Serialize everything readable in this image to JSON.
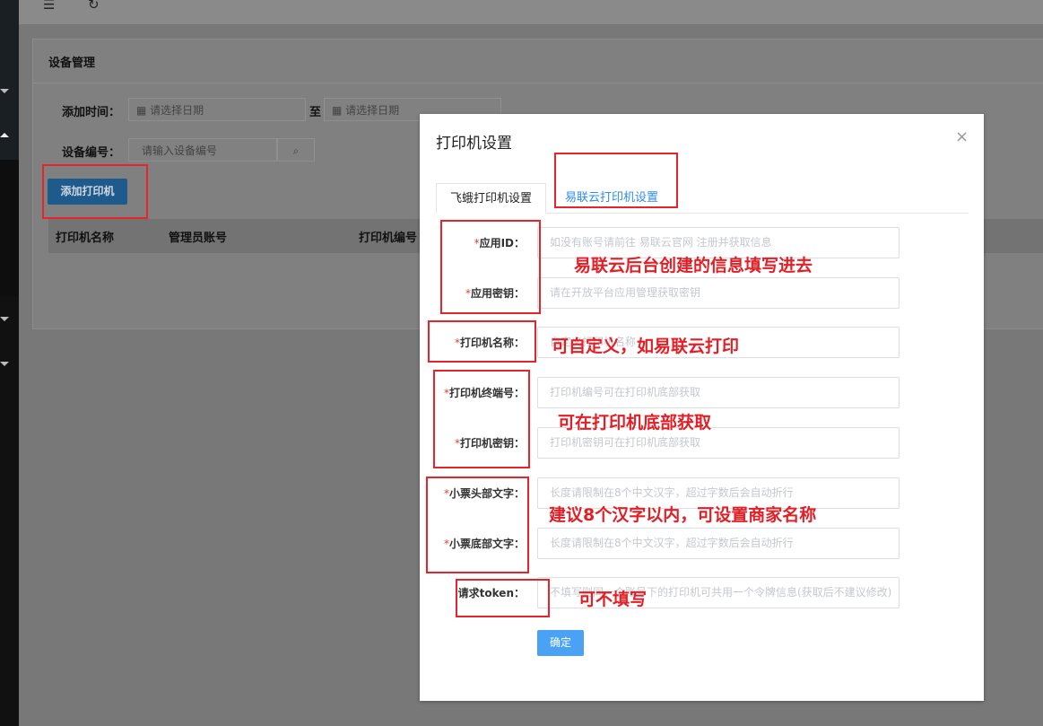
{
  "page": {
    "section_title": "设备管理",
    "filters": {
      "add_time_label": "添加时间：",
      "date_placeholder_start": "请选择日期",
      "date_to": "至",
      "date_placeholder_end": "请选择日期",
      "device_no_label": "设备编号：",
      "device_no_placeholder": "请输入设备编号"
    },
    "add_printer_button": "添加打印机",
    "table_headers": [
      "打印机名称",
      "管理员账号",
      "打印机编号"
    ]
  },
  "modal": {
    "title": "打印机设置",
    "close": "×",
    "tabs": [
      {
        "label": "飞蛾打印机设置",
        "active": true
      },
      {
        "label": "易联云打印机设置",
        "active": false
      }
    ],
    "fields": [
      {
        "required": true,
        "label": "应用ID：",
        "placeholder": "如没有账号请前往 易联云官网 注册并获取信息"
      },
      {
        "required": true,
        "label": "应用密钥：",
        "placeholder": "请在开放平台应用管理获取密钥"
      },
      {
        "required": true,
        "label": "打印机名称：",
        "placeholder": "自定义打印机名称"
      },
      {
        "required": true,
        "label": "打印机终端号：",
        "placeholder": "打印机编号可在打印机底部获取"
      },
      {
        "required": true,
        "label": "打印机密钥：",
        "placeholder": "打印机密钥可在打印机底部获取"
      },
      {
        "required": true,
        "label": "小票头部文字：",
        "placeholder": "长度请限制在8个中文汉字，超过字数后会自动折行"
      },
      {
        "required": true,
        "label": "小票底部文字：",
        "placeholder": "长度请限制在8个中文汉字，超过字数后会自动折行"
      },
      {
        "required": false,
        "label": "请求token：",
        "placeholder": "不填写则同一个账号下的打印机可共用一个令牌信息(获取后不建议修改)"
      }
    ],
    "confirm_button": "确定"
  },
  "annotations": [
    "易联云后台创建的信息填写进去",
    "可自定义，如易联云打印",
    "可在打印机底部获取",
    "建议8个汉字以内，可设置商家名称",
    "可不填写"
  ],
  "colors": {
    "primary": "#2d8cf0",
    "confirm": "#4aa2f5",
    "annotation_red": "#e31e25",
    "required_star": "#e03e2d"
  },
  "icons": [
    "menu-fold-icon",
    "refresh-icon",
    "calendar-icon",
    "search-icon",
    "close-icon"
  ]
}
